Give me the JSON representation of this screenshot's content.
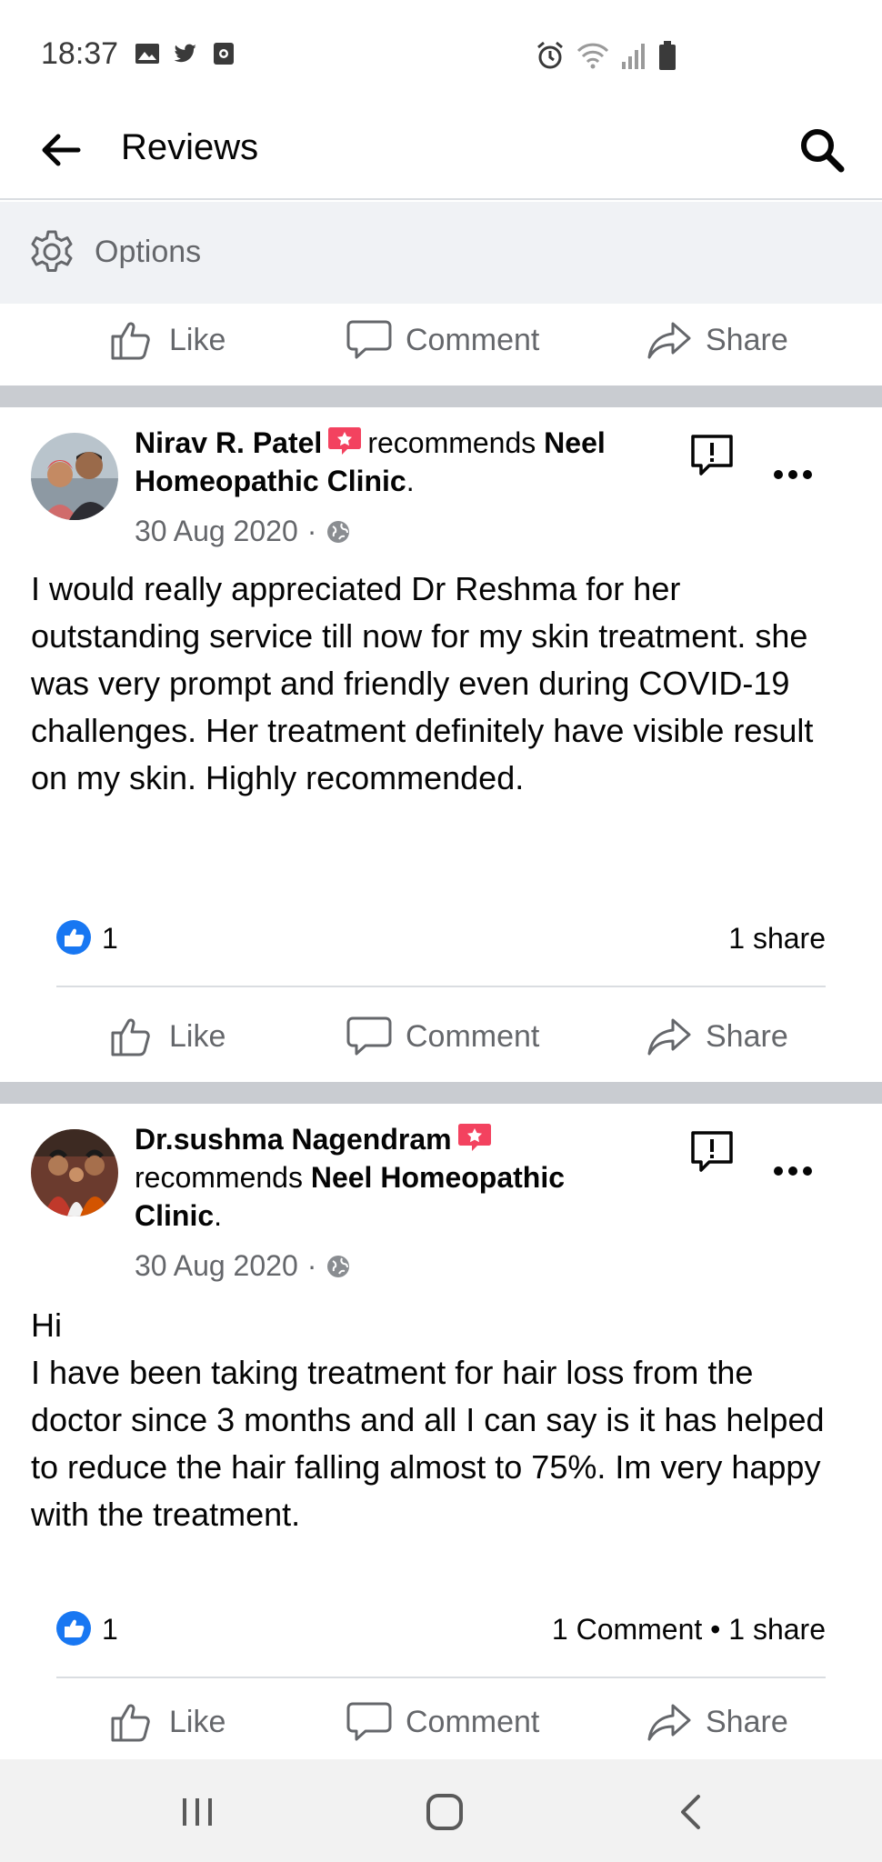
{
  "status_bar": {
    "time": "18:37",
    "left_icons": [
      "gallery-icon",
      "twitter-icon",
      "screen-record-icon"
    ],
    "right_icons": [
      "alarm-icon",
      "wifi-icon",
      "signal-icon",
      "battery-icon"
    ]
  },
  "header": {
    "title": "Reviews"
  },
  "options": {
    "label": "Options"
  },
  "actions": {
    "like": "Like",
    "comment": "Comment",
    "share": "Share"
  },
  "reviews": [
    {
      "author": "Nirav R. Patel",
      "verb": "recommends",
      "page": "Neel Homeopathic Clinic",
      "period": ".",
      "date": "30 Aug 2020",
      "date_sep": "·",
      "text": "I would really appreciated Dr Reshma for her outstanding service till now for my skin treatment. she was very prompt and friendly even during COVID-19 challenges. Her treatment definitely have visible result on my skin. Highly recommended.",
      "like_count": "1",
      "stats_right": "1 share"
    },
    {
      "author": "Dr.sushma Nagendram",
      "verb": "recommends",
      "page": "Neel Homeopathic Clinic",
      "period": ".",
      "date": "30 Aug 2020",
      "date_sep": "·",
      "text": "Hi\nI have been taking treatment for hair loss from the doctor since 3 months and all I can say is it has helped to reduce the hair falling almost to 75%. Im very happy with the treatment.",
      "like_count": "1",
      "stats_right": "1 Comment • 1 share"
    }
  ],
  "colors": {
    "accent_blue": "#1877f2",
    "recommend_badge": "#f3425f",
    "secondary_text": "#65676b",
    "separator": "#c9ccd1"
  }
}
